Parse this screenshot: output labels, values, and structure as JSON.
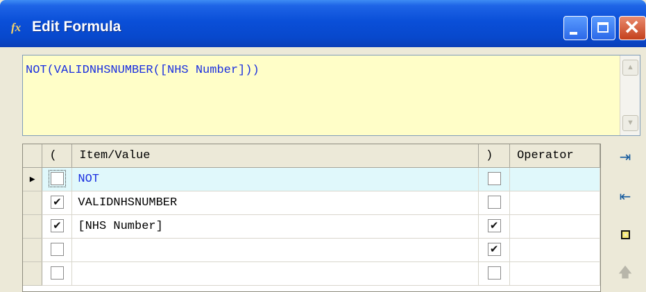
{
  "window": {
    "title": "Edit Formula",
    "title_icon": "fx-icon",
    "controls": {
      "minimize": "minimize-icon",
      "maximize": "maximize-icon",
      "close": "close-icon",
      "close_glyph": "✕"
    }
  },
  "formula": {
    "text": "NOT(VALIDNHSNUMBER([NHS Number]))"
  },
  "grid": {
    "columns": {
      "open_paren": "(",
      "item_value": "Item/Value",
      "close_paren": ")",
      "operator": "Operator"
    },
    "rows": [
      {
        "current": true,
        "open": false,
        "item": "NOT",
        "close": false,
        "operator": ""
      },
      {
        "current": false,
        "open": true,
        "item": "VALIDNHSNUMBER",
        "close": false,
        "operator": ""
      },
      {
        "current": false,
        "open": true,
        "item": "[NHS Number]",
        "close": true,
        "operator": ""
      },
      {
        "current": false,
        "open": false,
        "item": "",
        "close": true,
        "operator": ""
      },
      {
        "current": false,
        "open": false,
        "item": "",
        "close": false,
        "operator": ""
      }
    ]
  },
  "toolbar": {
    "insert_row_after": "insert-row-after-icon",
    "insert_row_before": "insert-row-before-icon",
    "clear_row": "clear-row-icon",
    "move_up": "move-up-icon"
  },
  "colors": {
    "formula_bg": "#fffec8",
    "formula_text": "#1a2fe0",
    "current_row_bg": "#e0f8fb",
    "titlebar": "#0a4fd8"
  }
}
